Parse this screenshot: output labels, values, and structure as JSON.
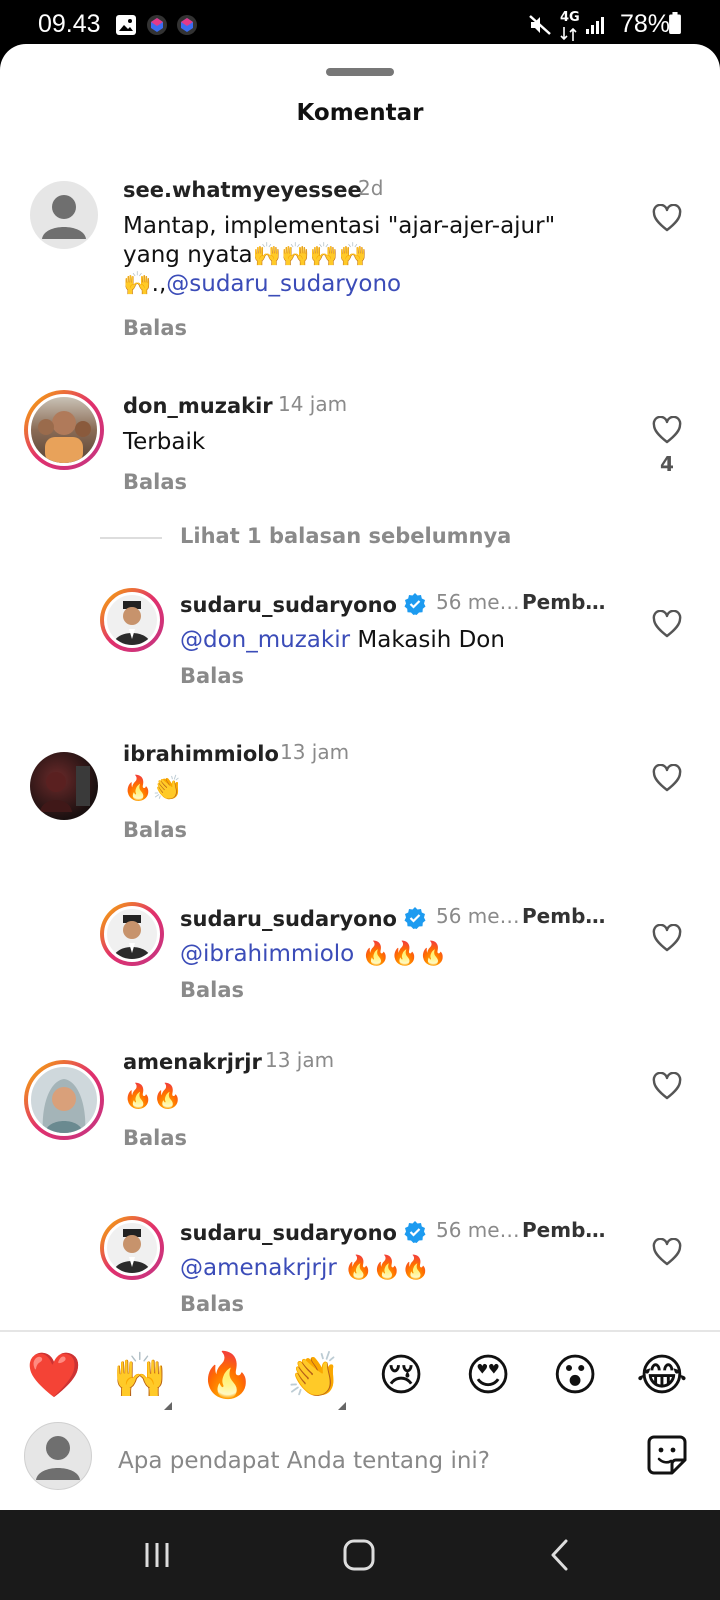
{
  "status": {
    "time": "09.43",
    "battery": "78%",
    "network": "4G"
  },
  "sheet": {
    "title": "Komentar"
  },
  "view_previous": "Lihat 1 balasan sebelumnya",
  "reply_label": "Balas",
  "comments": [
    {
      "username": "see.whatmyeyessee",
      "time": "2d",
      "text_line1": "Mantap, implementasi \"ajar-ajer-ajur\"",
      "text_line2": "yang nyata🙌🙌🙌🙌",
      "text_line3_prefix": "🙌.,",
      "mention": "@sudaru_sudaryono"
    },
    {
      "username": "don_muzakir",
      "time": "14 jam",
      "text": "Terbaik",
      "likes": "4"
    },
    {
      "username": "sudaru_sudaryono",
      "time": "56 me…",
      "tag": "Pemb…",
      "mention": "@don_muzakir",
      "text": " Makasih Don"
    },
    {
      "username": "ibrahimmiolo",
      "time": "13 jam",
      "text": "🔥👏"
    },
    {
      "username": "sudaru_sudaryono",
      "time": "56 me…",
      "tag": "Pemb…",
      "mention": "@ibrahimmiolo",
      "text": " 🔥🔥🔥"
    },
    {
      "username": "amenakrjrjr",
      "time": "13 jam",
      "text": "🔥🔥"
    },
    {
      "username": "sudaru_sudaryono",
      "time": "56 me…",
      "tag": "Pemb…",
      "mention": "@amenakrjrjr",
      "text": " 🔥🔥🔥"
    }
  ],
  "emoji_bar": [
    "❤️",
    "🙌",
    "🔥",
    "👏",
    "😢",
    "😍",
    "😮",
    "😂"
  ],
  "input": {
    "placeholder": "Apa pendapat Anda tentang ini?"
  },
  "colors": {
    "mention": "#3b4cb8",
    "verified": "#1d9bf0",
    "ring_start": "#f7b500",
    "ring_end": "#c13584"
  },
  "icons": {
    "heart": "heart-outline-icon",
    "sticker": "sticker-icon",
    "nav_recent": "recent-apps-icon",
    "nav_home": "home-icon",
    "nav_back": "back-icon"
  }
}
